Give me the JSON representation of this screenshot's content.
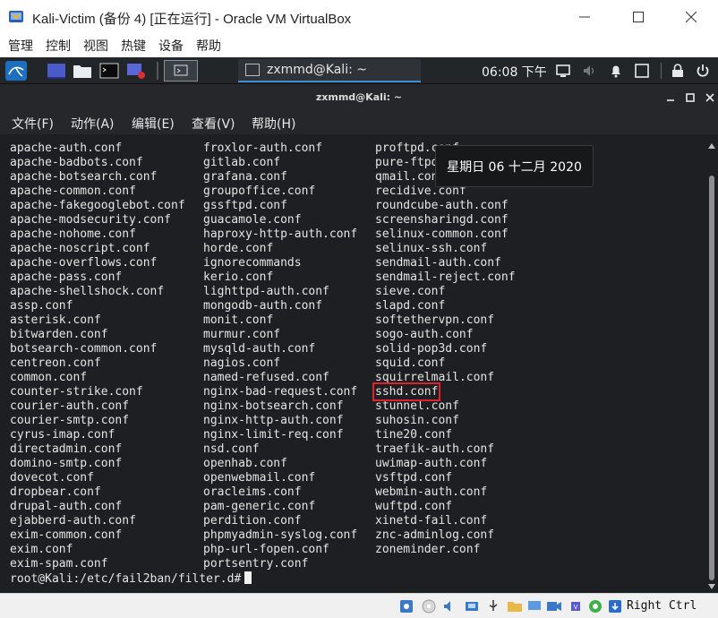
{
  "window": {
    "title": "Kali-Victim (备份 4) [正在运行] - Oracle VM VirtualBox"
  },
  "host_menu": [
    "管理",
    "控制",
    "视图",
    "热键",
    "设备",
    "帮助"
  ],
  "kali_panel": {
    "task_label": "zxmmd@Kali: ~",
    "clock": "06:08 下午"
  },
  "terminal": {
    "title": "zxmmd@Kali: ~",
    "menu": [
      "文件(F)",
      "动作(A)",
      "编辑(E)",
      "查看(V)",
      "帮助(H)"
    ],
    "columns": [
      [
        "apache-auth.conf",
        "apache-badbots.conf",
        "apache-botsearch.conf",
        "apache-common.conf",
        "apache-fakegooglebot.conf",
        "apache-modsecurity.conf",
        "apache-nohome.conf",
        "apache-noscript.conf",
        "apache-overflows.conf",
        "apache-pass.conf",
        "apache-shellshock.conf",
        "assp.conf",
        "asterisk.conf",
        "bitwarden.conf",
        "botsearch-common.conf",
        "centreon.conf",
        "common.conf",
        "counter-strike.conf",
        "courier-auth.conf",
        "courier-smtp.conf",
        "cyrus-imap.conf",
        "directadmin.conf",
        "domino-smtp.conf",
        "dovecot.conf",
        "dropbear.conf",
        "drupal-auth.conf",
        "ejabberd-auth.conf",
        "exim-common.conf",
        "exim.conf",
        "exim-spam.conf"
      ],
      [
        "froxlor-auth.conf",
        "gitlab.conf",
        "grafana.conf",
        "groupoffice.conf",
        "gssftpd.conf",
        "guacamole.conf",
        "haproxy-http-auth.conf",
        "horde.conf",
        "ignorecommands",
        "kerio.conf",
        "lighttpd-auth.conf",
        "mongodb-auth.conf",
        "monit.conf",
        "murmur.conf",
        "mysqld-auth.conf",
        "nagios.conf",
        "named-refused.conf",
        "nginx-bad-request.conf",
        "nginx-botsearch.conf",
        "nginx-http-auth.conf",
        "nginx-limit-req.conf",
        "nsd.conf",
        "openhab.conf",
        "openwebmail.conf",
        "oracleims.conf",
        "pam-generic.conf",
        "perdition.conf",
        "phpmyadmin-syslog.conf",
        "php-url-fopen.conf",
        "portsentry.conf"
      ],
      [
        "proftpd.conf",
        "pure-ftpd.conf",
        "qmail.conf",
        "recidive.conf",
        "roundcube-auth.conf",
        "screensharingd.conf",
        "selinux-common.conf",
        "selinux-ssh.conf",
        "sendmail-auth.conf",
        "sendmail-reject.conf",
        "sieve.conf",
        "slapd.conf",
        "softethervpn.conf",
        "sogo-auth.conf",
        "solid-pop3d.conf",
        "squid.conf",
        "squirrelmail.conf",
        "sshd.conf",
        "stunnel.conf",
        "suhosin.conf",
        "tine20.conf",
        "traefik-auth.conf",
        "uwimap-auth.conf",
        "vsftpd.conf",
        "webmin-auth.conf",
        "wuftpd.conf",
        "xinetd-fail.conf",
        "znc-adminlog.conf",
        "zoneminder.conf"
      ]
    ],
    "highlighted_file": "sshd.conf",
    "prompt": "root@Kali:/etc/fail2ban/filter.d#"
  },
  "tooltip": "星期日 06 十二月 2020",
  "vbox_status": {
    "host_key": "Right Ctrl"
  },
  "colors": {
    "highlight_box": "#e0202a",
    "terminal_bg": "#1e1f22",
    "panel_bg": "#232629"
  }
}
